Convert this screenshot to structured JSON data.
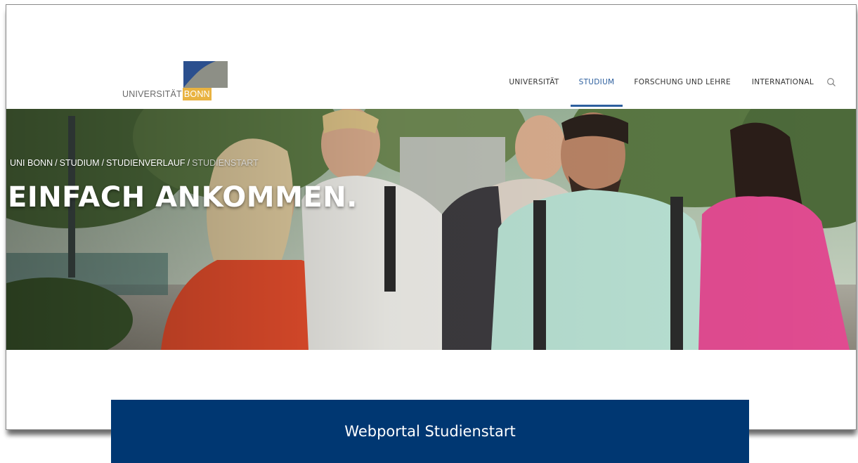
{
  "header": {
    "logo": {
      "text": "UNIVERSITÄT",
      "highlight": "BONN",
      "highlight_color": "#e9b341",
      "mark_colors": [
        "#2b4f8e",
        "#8d8f86"
      ]
    },
    "nav": {
      "items": [
        {
          "label": "UNIVERSITÄT",
          "active": false
        },
        {
          "label": "STUDIUM",
          "active": true
        },
        {
          "label": "FORSCHUNG UND LEHRE",
          "active": false
        },
        {
          "label": "INTERNATIONAL",
          "active": false
        }
      ],
      "search_icon": "search-icon",
      "active_color": "#2d5f9e"
    }
  },
  "hero": {
    "breadcrumb": [
      "UNI BONN",
      "STUDIUM",
      "STUDIENVERLAUF",
      "STUDIENSTART"
    ],
    "breadcrumb_separator": "/",
    "title": "EINFACH ANKOMMEN."
  },
  "cta": {
    "label": "Webportal Studienstart",
    "color": "#003772"
  }
}
